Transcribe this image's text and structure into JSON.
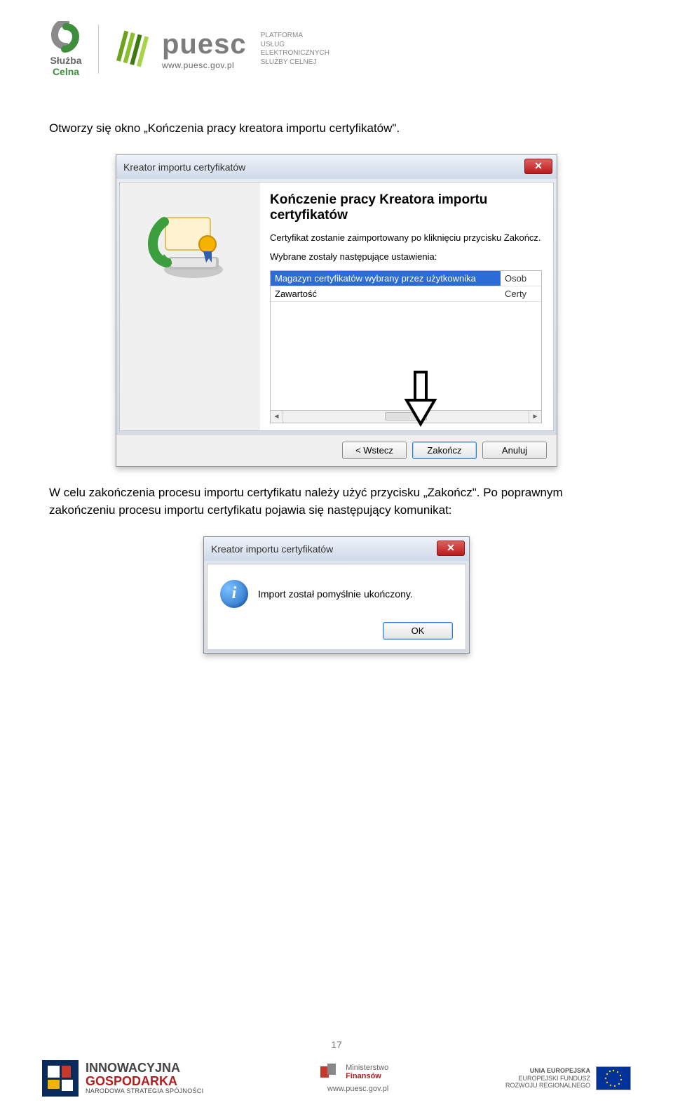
{
  "header": {
    "sluzba_line1": "Służba",
    "sluzba_line2": "Celna",
    "puesc_brand": "puesc",
    "puesc_url": "www.puesc.gov.pl",
    "platform_l1": "PLATFORMA",
    "platform_l2": "USŁUG",
    "platform_l3": "ELEKTRONICZNYCH",
    "platform_l4": "SŁUŻBY CELNEJ"
  },
  "body": {
    "intro_text": "Otworzy się okno „Kończenia pracy kreatora importu certyfikatów\".",
    "middle_text": "W celu zakończenia procesu importu certyfikatu należy użyć przycisku „Zakończ\". Po poprawnym zakończeniu procesu importu certyfikatu pojawia się następujący komunikat:"
  },
  "dialog1": {
    "title": "Kreator importu certyfikatów",
    "heading": "Kończenie pracy Kreatora importu certyfikatów",
    "line1": "Certyfikat zostanie zaimportowany po kliknięciu przycisku Zakończ.",
    "line2": "Wybrane zostały następujące ustawienia:",
    "row1_left": "Magazyn certyfikatów wybrany przez użytkownika",
    "row1_right": "Osob",
    "row2_left": "Zawartość",
    "row2_right": "Certy",
    "btn_back": "< Wstecz",
    "btn_finish": "Zakończ",
    "btn_cancel": "Anuluj"
  },
  "dialog2": {
    "title": "Kreator importu certyfikatów",
    "message": "Import został pomyślnie ukończony.",
    "btn_ok": "OK"
  },
  "footer": {
    "page_number": "17",
    "ig_l1": "INNOWACYJNA",
    "ig_l2": "GOSPODARKA",
    "ig_l3": "NARODOWA STRATEGIA SPÓJNOŚCI",
    "mf_l1": "Ministerstwo",
    "mf_l2": "Finansów",
    "eu_l1": "UNIA EUROPEJSKA",
    "eu_l2": "EUROPEJSKI FUNDUSZ",
    "eu_l3": "ROZWOJU REGIONALNEGO",
    "site_url": "www.puesc.gov.pl"
  }
}
